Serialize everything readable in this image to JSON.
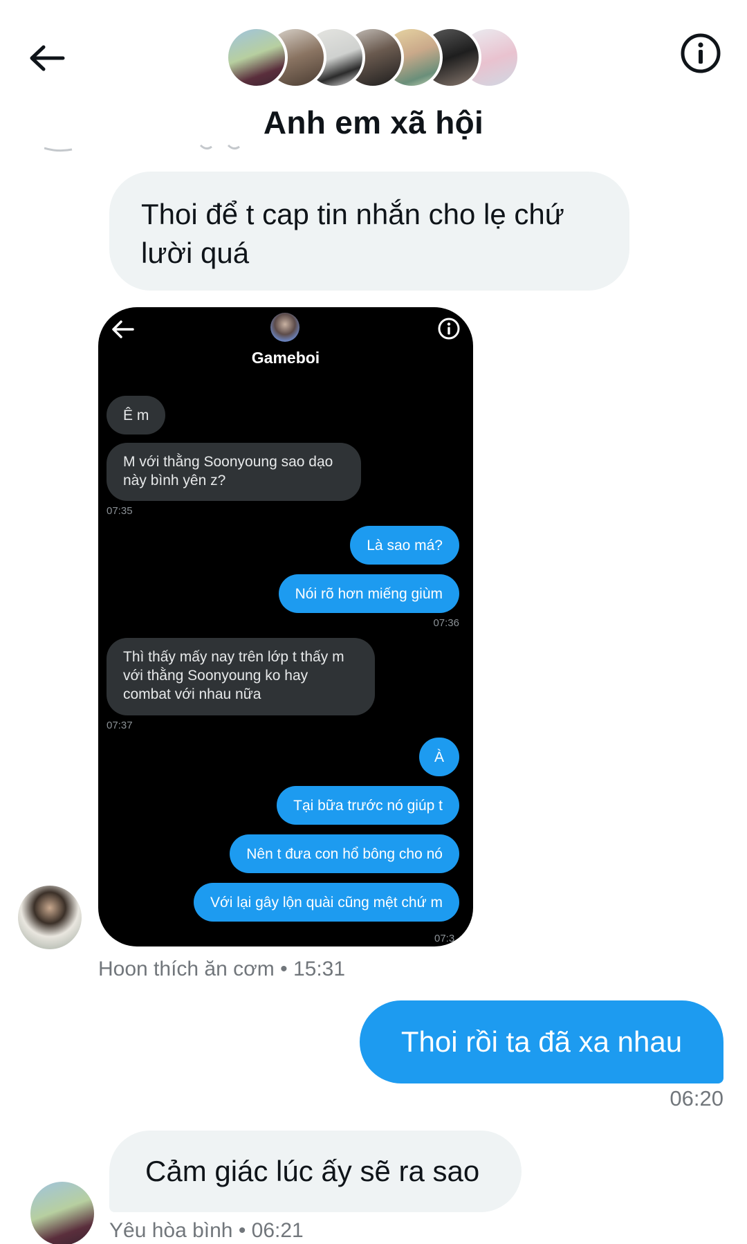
{
  "header": {
    "title": "Anh em xã hội",
    "back_icon": "arrow-left-icon",
    "info_icon": "info-circle-icon",
    "member_avatar_count": 7
  },
  "messages": {
    "msg1": "Thoi để t cap tin nhắn cho lẹ chứ lười quá",
    "msg1_meta": "Hoon thích ăn cơm • 15:31",
    "msg3": "Thoi rồi ta đã xa nhau",
    "msg3_time": "06:20",
    "msg4": "Cảm giác lúc ấy sẽ ra sao",
    "msg4_meta": "Yêu hòa bình • 06:21"
  },
  "screenshot": {
    "title": "Gameboi",
    "bubbles": [
      {
        "text": "Ê m",
        "side": "in"
      },
      {
        "text": "M với thằng Soonyoung sao dạo này bình yên z?",
        "side": "in"
      },
      {
        "text": "Là sao má?",
        "side": "out"
      },
      {
        "text": "Nói rõ hơn miếng giùm",
        "side": "out"
      },
      {
        "text": "Thì thấy mấy nay trên lớp t thấy m với thằng Soonyoung ko hay combat với nhau nữa",
        "side": "in"
      },
      {
        "text": "À",
        "side": "out"
      },
      {
        "text": "Tại bữa trước nó giúp t",
        "side": "out"
      },
      {
        "text": "Nên t đưa con hổ bông cho nó",
        "side": "out"
      },
      {
        "text": "Với lại gây lộn quài cũng mệt chứ m",
        "side": "out"
      }
    ],
    "times": [
      "07:35",
      "07:36",
      "07:37",
      "07:3"
    ]
  },
  "colors": {
    "accent": "#1d9bf0",
    "incoming_bubble": "#eff3f4",
    "screenshot_bg": "#000000",
    "meta_text": "#71767b"
  }
}
